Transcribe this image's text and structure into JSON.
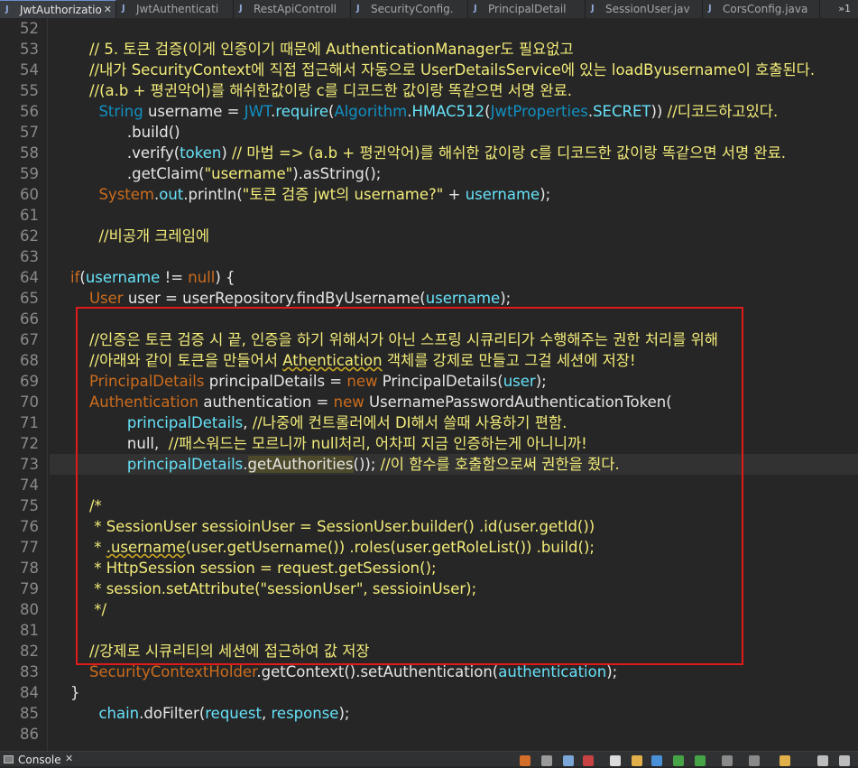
{
  "tabs": [
    {
      "label": "JwtAuthorizatio",
      "active": true,
      "closable": true,
      "icon": "java-file-icon"
    },
    {
      "label": "JwtAuthenticati",
      "active": false,
      "icon": "java-file-icon"
    },
    {
      "label": "RestApiControll",
      "active": false,
      "icon": "java-file-icon"
    },
    {
      "label": "SecurityConfig.",
      "active": false,
      "icon": "java-file-icon"
    },
    {
      "label": "PrincipalDetail",
      "active": false,
      "icon": "java-file-icon"
    },
    {
      "label": "SessionUser.jav",
      "active": false,
      "icon": "java-file-icon"
    },
    {
      "label": "CorsConfig.java",
      "active": false,
      "icon": "java-file-icon"
    }
  ],
  "overflow_label": "»1",
  "colors": {
    "comment": "#f3ec79",
    "keyword": "#cc6c1d",
    "type": "#1290c3",
    "field": "#66e1f8",
    "string": "#17c6a3",
    "highlight_box": "#e01a1a"
  },
  "current_line": 73,
  "lines": [
    {
      "n": 52,
      "tokens": []
    },
    {
      "n": 53,
      "tokens": [
        {
          "t": "        "
        },
        {
          "t": "// 5. 토큰 검증(이게 인증이기 때문에 AuthenticationManager도 필요없고",
          "c": "c"
        }
      ]
    },
    {
      "n": 54,
      "tokens": [
        {
          "t": "        "
        },
        {
          "t": "//내가 SecurityContext에 직접 접근해서 자동으로 UserDetailsService에 있는 loadByusername이 호출된다.",
          "c": "c"
        }
      ]
    },
    {
      "n": 55,
      "tokens": [
        {
          "t": "        "
        },
        {
          "t": "//(a.b + 평귄악어)를 해쉬한값이랑 c를 디코드한 값이랑 똑같으면 서명 완료.",
          "c": "c"
        }
      ]
    },
    {
      "n": 56,
      "tokens": [
        {
          "t": "          "
        },
        {
          "t": "String",
          "c": "t"
        },
        {
          "t": " username = "
        },
        {
          "t": "JWT",
          "c": "t"
        },
        {
          "t": "."
        },
        {
          "t": "require",
          "c": "f"
        },
        {
          "t": "("
        },
        {
          "t": "Algorithm",
          "c": "t"
        },
        {
          "t": "."
        },
        {
          "t": "HMAC512",
          "c": "f"
        },
        {
          "t": "("
        },
        {
          "t": "JwtProperties",
          "c": "t"
        },
        {
          "t": "."
        },
        {
          "t": "SECRET",
          "c": "f"
        },
        {
          "t": ")) "
        },
        {
          "t": "//디코드하고있다.",
          "c": "c"
        }
      ]
    },
    {
      "n": 57,
      "tokens": [
        {
          "t": "                "
        },
        {
          "t": ".build()"
        }
      ]
    },
    {
      "n": 58,
      "tokens": [
        {
          "t": "                "
        },
        {
          "t": ".verify("
        },
        {
          "t": "token",
          "c": "f"
        },
        {
          "t": ") "
        },
        {
          "t": "// 마법 => (a.b + 평귄악어)를 해쉬한 값이랑 c를 디코드한 값이랑 똑같으면 서명 완료.",
          "c": "c"
        }
      ]
    },
    {
      "n": 59,
      "tokens": [
        {
          "t": "                "
        },
        {
          "t": ".getClaim("
        },
        {
          "t": "\"username\"",
          "c": "c"
        },
        {
          "t": ").asString();"
        }
      ]
    },
    {
      "n": 60,
      "tokens": [
        {
          "t": "          "
        },
        {
          "t": "System",
          "c": "k"
        },
        {
          "t": "."
        },
        {
          "t": "out",
          "c": "f"
        },
        {
          "t": ".println("
        },
        {
          "t": "\"토큰 검증 jwt의 username?\"",
          "c": "c"
        },
        {
          "t": " + "
        },
        {
          "t": "username",
          "c": "f"
        },
        {
          "t": ");"
        }
      ]
    },
    {
      "n": 61,
      "tokens": []
    },
    {
      "n": 62,
      "tokens": [
        {
          "t": "          "
        },
        {
          "t": "//비공개 크레임에",
          "c": "c"
        }
      ]
    },
    {
      "n": 63,
      "tokens": []
    },
    {
      "n": 64,
      "tokens": [
        {
          "t": "    "
        },
        {
          "t": "if",
          "c": "k"
        },
        {
          "t": "("
        },
        {
          "t": "username",
          "c": "f"
        },
        {
          "t": " != "
        },
        {
          "t": "null",
          "c": "k"
        },
        {
          "t": ") {"
        }
      ]
    },
    {
      "n": 65,
      "tokens": [
        {
          "t": "        "
        },
        {
          "t": "User",
          "c": "k"
        },
        {
          "t": " user = userRepository.findByUsername("
        },
        {
          "t": "username",
          "c": "f"
        },
        {
          "t": ");"
        }
      ]
    },
    {
      "n": 66,
      "tokens": []
    },
    {
      "n": 67,
      "tokens": [
        {
          "t": "        "
        },
        {
          "t": "//인증은 토큰 검증 시 끝, 인증을 하기 위해서가 아닌 스프링 시큐리티가 수행해주는 권한 처리를 위해",
          "c": "c"
        }
      ]
    },
    {
      "n": 68,
      "tokens": [
        {
          "t": "        "
        },
        {
          "t": "//아래와 같이 토큰을 만들어서 ",
          "c": "c"
        },
        {
          "t": "Athentication",
          "c": "c",
          "sq": true
        },
        {
          "t": " 객체를 강제로 만들고 그걸 세션에 저장!",
          "c": "c"
        }
      ]
    },
    {
      "n": 69,
      "tokens": [
        {
          "t": "        "
        },
        {
          "t": "PrincipalDetails",
          "c": "k"
        },
        {
          "t": " principalDetails = "
        },
        {
          "t": "new",
          "c": "k"
        },
        {
          "t": " PrincipalDetails("
        },
        {
          "t": "user",
          "c": "f"
        },
        {
          "t": ");"
        }
      ]
    },
    {
      "n": 70,
      "tokens": [
        {
          "t": "        "
        },
        {
          "t": "Authentication",
          "c": "k"
        },
        {
          "t": " authentication = "
        },
        {
          "t": "new",
          "c": "k"
        },
        {
          "t": " UsernamePasswordAuthenticationToken("
        }
      ]
    },
    {
      "n": 71,
      "tokens": [
        {
          "t": "                "
        },
        {
          "t": "principalDetails",
          "c": "f"
        },
        {
          "t": ", "
        },
        {
          "t": "//나중에 컨트롤러에서 DI해서 쓸때 사용하기 편함.",
          "c": "c"
        }
      ]
    },
    {
      "n": 72,
      "tokens": [
        {
          "t": "                "
        },
        {
          "t": "null"
        },
        {
          "t": ",  "
        },
        {
          "t": "//패스워드는 모르니까 null처리, 어차피 지금 인증하는게 아니니까!",
          "c": "c"
        }
      ]
    },
    {
      "n": 73,
      "tokens": [
        {
          "t": "                "
        },
        {
          "t": "principalDetails",
          "c": "f"
        },
        {
          "t": "."
        },
        {
          "t": "getAuthorities",
          "hl": true
        },
        {
          "t": "()); "
        },
        {
          "t": "//이 함수를 호출함으로써 권한을 줬다.",
          "c": "c"
        }
      ]
    },
    {
      "n": 74,
      "tokens": []
    },
    {
      "n": 75,
      "tokens": [
        {
          "t": "        "
        },
        {
          "t": "/*",
          "c": "c"
        }
      ]
    },
    {
      "n": 76,
      "tokens": [
        {
          "t": "         "
        },
        {
          "t": "* SessionUser sessioinUser = SessionUser.builder() .id(user.getId())",
          "c": "c"
        }
      ]
    },
    {
      "n": 77,
      "tokens": [
        {
          "t": "         "
        },
        {
          "t": "* ",
          "c": "c"
        },
        {
          "t": ".username",
          "c": "c",
          "sq": true
        },
        {
          "t": "(user.getUsername()) .roles(user.getRoleList()) .build();",
          "c": "c"
        }
      ]
    },
    {
      "n": 78,
      "tokens": [
        {
          "t": "         "
        },
        {
          "t": "* HttpSession session = request.getSession();",
          "c": "c"
        }
      ]
    },
    {
      "n": 79,
      "tokens": [
        {
          "t": "         "
        },
        {
          "t": "* session.setAttribute(\"sessionUser\", sessioinUser);",
          "c": "c"
        }
      ]
    },
    {
      "n": 80,
      "tokens": [
        {
          "t": "         "
        },
        {
          "t": "*/",
          "c": "c"
        }
      ]
    },
    {
      "n": 81,
      "tokens": []
    },
    {
      "n": 82,
      "tokens": [
        {
          "t": "        "
        },
        {
          "t": "//강제로 시큐리티의 세션에 접근하여 값 저장",
          "c": "c"
        }
      ]
    },
    {
      "n": 83,
      "tokens": [
        {
          "t": "        "
        },
        {
          "t": "SecurityContextHolder",
          "c": "k"
        },
        {
          "t": ".getContext().setAuthentication("
        },
        {
          "t": "authentication",
          "c": "f"
        },
        {
          "t": ");"
        }
      ]
    },
    {
      "n": 84,
      "tokens": [
        {
          "t": "    "
        },
        {
          "t": "}"
        }
      ]
    },
    {
      "n": 85,
      "tokens": [
        {
          "t": "          "
        },
        {
          "t": "chain",
          "c": "f"
        },
        {
          "t": ".doFilter("
        },
        {
          "t": "request",
          "c": "f"
        },
        {
          "t": ", "
        },
        {
          "t": "response",
          "c": "f"
        },
        {
          "t": ");"
        }
      ]
    },
    {
      "n": 86,
      "tokens": []
    }
  ],
  "console": {
    "label": "Console",
    "icon": "console-icon"
  }
}
